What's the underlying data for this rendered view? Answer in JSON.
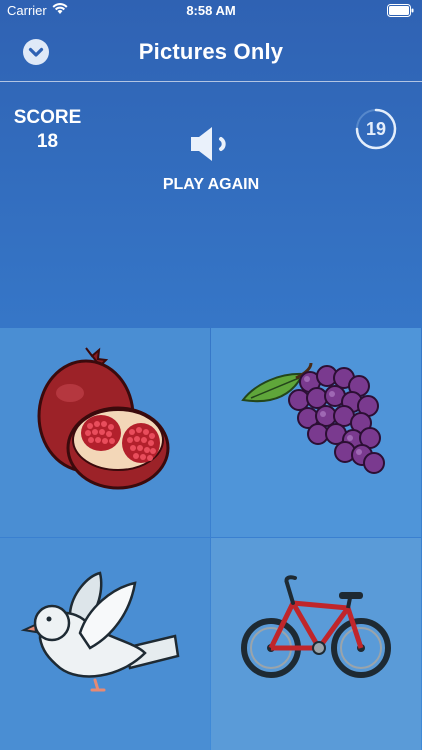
{
  "status_bar": {
    "carrier": "Carrier",
    "time": "8:58 AM"
  },
  "nav": {
    "title": "Pictures Only",
    "collapse_icon": "chevron-down-icon"
  },
  "game": {
    "score_label": "SCORE",
    "score": "18",
    "play_again_label": "PLAY AGAIN",
    "timer": "19",
    "timer_progress": 0.75
  },
  "tiles": [
    {
      "icon": "pomegranate-icon"
    },
    {
      "icon": "grapes-icon"
    },
    {
      "icon": "dove-icon"
    },
    {
      "icon": "bicycle-icon"
    }
  ],
  "colors": {
    "background": "#3677c8",
    "tile": "#4a8ed3",
    "white": "#ffffff"
  }
}
